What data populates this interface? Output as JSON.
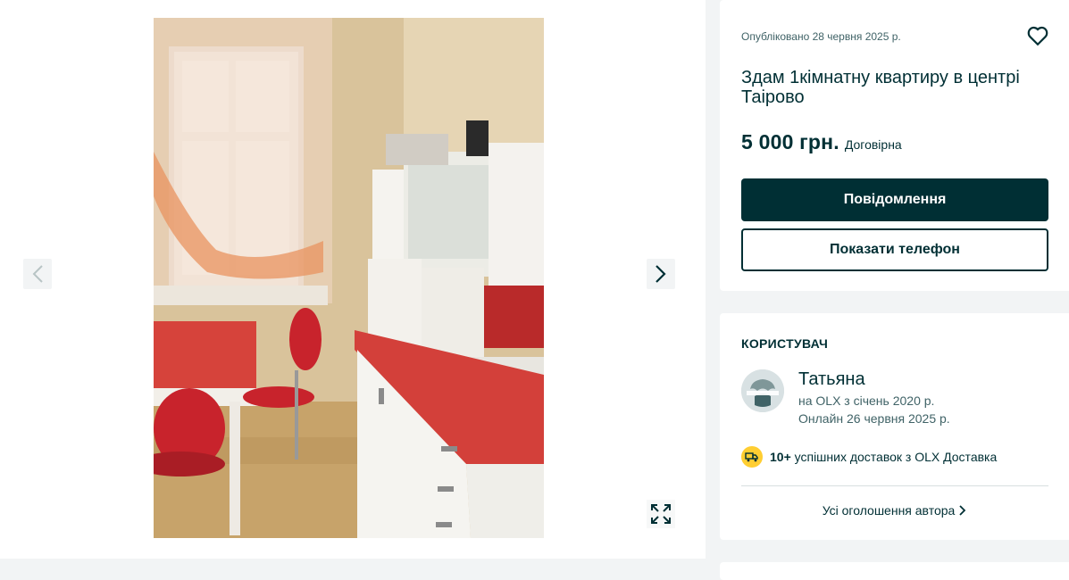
{
  "gallery": {
    "photo_alt": "",
    "prev_icon": "chevron-left-icon",
    "next_icon": "chevron-right-icon",
    "fullscreen_icon": "expand-icon"
  },
  "listing": {
    "posted": "Опубліковано 28 червня 2025 р.",
    "favorite_icon": "heart-icon",
    "title": "Здам 1кімнатну квартиру в центрі Таірово",
    "price": "5 000 грн.",
    "negotiable": "Договірна",
    "message_button": "Повідомлення",
    "phone_button": "Показати телефон"
  },
  "seller": {
    "heading": "КОРИСТУВАЧ",
    "name": "Татьяна",
    "member_since": "на OLX з січень 2020 р.",
    "last_online": "Онлайн 26 червня 2025 р.",
    "deliveries_count": "10+",
    "deliveries_text": "успішних доставок з OLX Доставка",
    "all_ads_link": "Усі оголошення автора"
  },
  "colors": {
    "brand_dark": "#002f34",
    "muted_text": "#406367",
    "badge_yellow": "#ffce32",
    "background": "#f2f4f5"
  }
}
